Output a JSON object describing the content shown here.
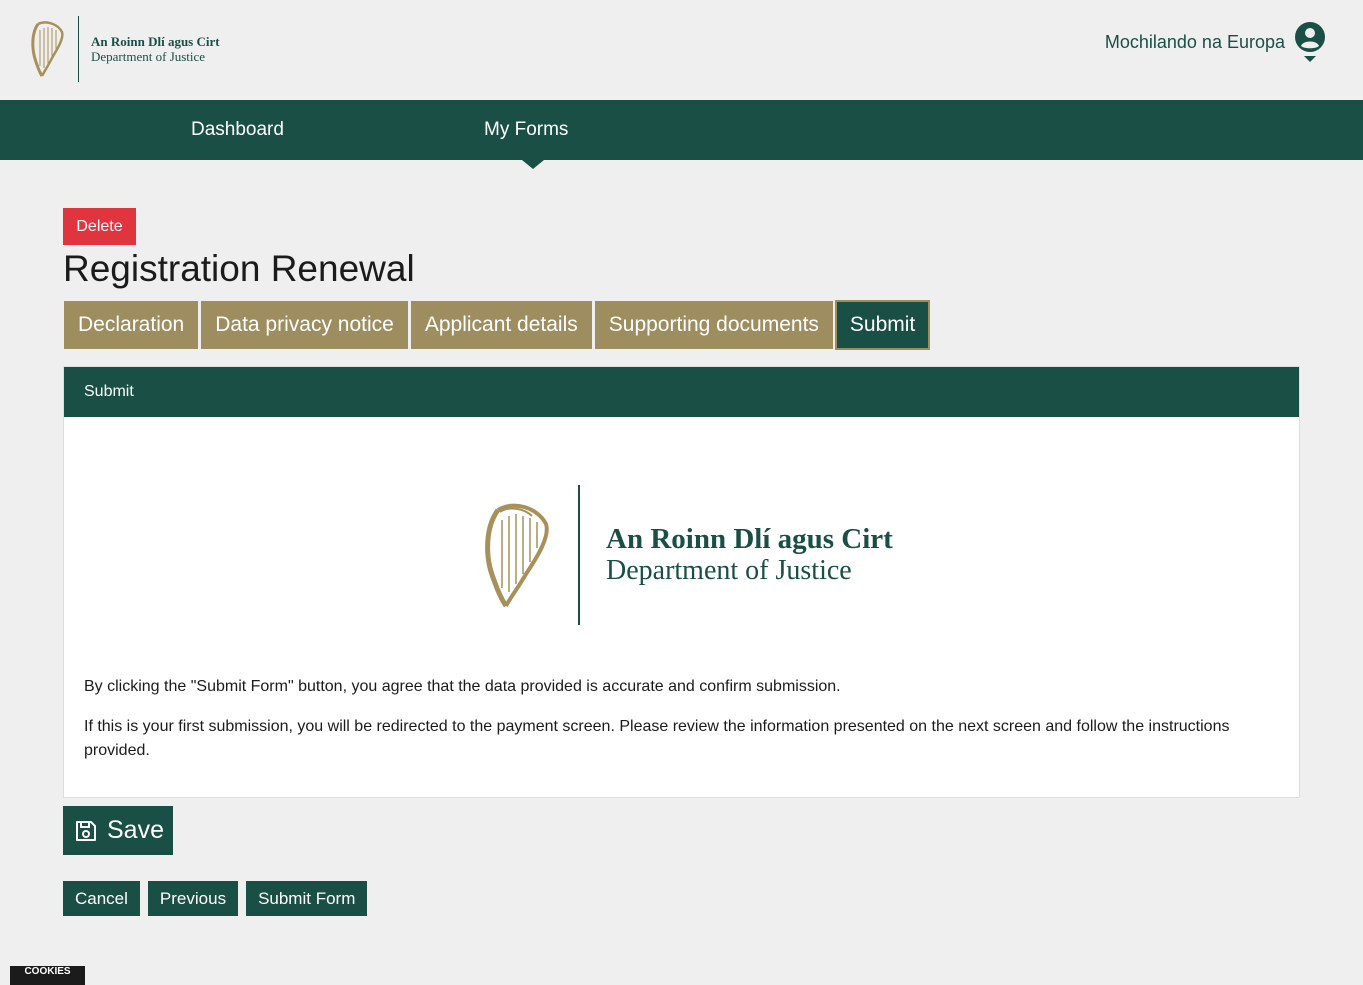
{
  "header": {
    "logo": {
      "irish": "An Roinn Dlí agus Cirt",
      "english": "Department of Justice"
    },
    "user_name": "Mochilando na Europa",
    "user_icon": "user-circle-icon"
  },
  "nav": {
    "items": [
      {
        "label": "Dashboard"
      },
      {
        "label": "My Forms"
      }
    ],
    "active": "My Forms"
  },
  "page": {
    "delete_label": "Delete",
    "title": "Registration Renewal"
  },
  "tabs": [
    {
      "label": "Declaration"
    },
    {
      "label": "Data privacy notice"
    },
    {
      "label": "Applicant details"
    },
    {
      "label": "Supporting documents"
    },
    {
      "label": "Submit"
    }
  ],
  "active_tab": "Submit",
  "panel": {
    "header": "Submit",
    "logo": {
      "irish": "An Roinn Dlí agus Cirt",
      "english": "Department of Justice"
    },
    "paragraphs": [
      "By clicking the \"Submit Form\" button, you agree that the data provided is accurate and confirm submission.",
      "If this is your first submission, you will be redirected to the payment screen. Please review the information presented on the next screen and follow the instructions provided."
    ]
  },
  "buttons": {
    "save": "Save",
    "cancel": "Cancel",
    "previous": "Previous",
    "submit_form": "Submit Form"
  },
  "cookies_label": "COOKIES",
  "colors": {
    "primary": "#1a4f45",
    "tab_gold": "#9e8e5f",
    "danger": "#e0353f",
    "background": "#efefef"
  }
}
